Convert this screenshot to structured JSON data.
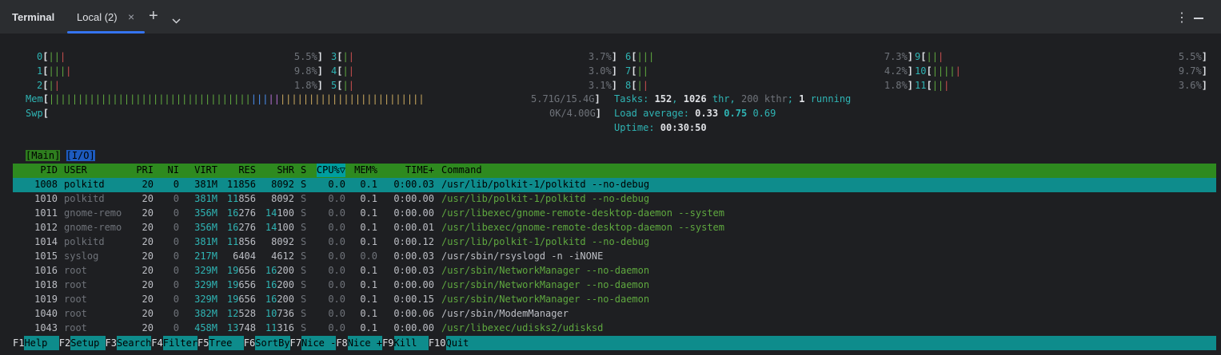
{
  "window": {
    "title": "Terminal",
    "tab_label": "Local (2)",
    "close_glyph": "×",
    "add_glyph": "+",
    "more_glyph": "⋮"
  },
  "cpus": [
    {
      "id": "0",
      "pct": "5.5%"
    },
    {
      "id": "1",
      "pct": "9.8%"
    },
    {
      "id": "2",
      "pct": "1.8%"
    },
    {
      "id": "3",
      "pct": "3.7%"
    },
    {
      "id": "4",
      "pct": "3.0%"
    },
    {
      "id": "5",
      "pct": "3.1%"
    },
    {
      "id": "6",
      "pct": "7.3%"
    },
    {
      "id": "7",
      "pct": "4.2%"
    },
    {
      "id": "8",
      "pct": "1.8%"
    },
    {
      "id": "9",
      "pct": "5.5%"
    },
    {
      "id": "10",
      "pct": "9.7%"
    },
    {
      "id": "11",
      "pct": "3.6%"
    }
  ],
  "mem": {
    "label": "Mem",
    "value": "5.71G/15.4G"
  },
  "swp": {
    "label": "Swp",
    "value": "0K/4.00G"
  },
  "tasks": {
    "prefix": "Tasks: ",
    "count": "152",
    "sep1": ", ",
    "threads": "1026",
    "thr_label": " thr",
    "sep2": ", ",
    "kthr": "200 kthr",
    "sep3": "; ",
    "running": "1",
    "running_label": " running"
  },
  "load": {
    "prefix": "Load average: ",
    "l1": "0.33",
    "l5": "0.75",
    "l15": "0.69"
  },
  "uptime": {
    "prefix": "Uptime: ",
    "value": "00:30:50"
  },
  "view_tabs": {
    "main": "[Main]",
    "io": "[I/O]"
  },
  "columns": {
    "pid": "PID",
    "user": "USER",
    "pri": "PRI",
    "ni": "NI",
    "virt": "VIRT",
    "res": "RES",
    "shr": "SHR",
    "s": "S",
    "cpu": "CPU%▽",
    "mem": "MEM%",
    "time": "TIME+",
    "command": "Command"
  },
  "processes": [
    {
      "pid": "1008",
      "user": "polkitd",
      "pri": "20",
      "ni": "0",
      "virt": "381M",
      "res": "11856",
      "shr": "8092",
      "s": "S",
      "cpu": "0.0",
      "mem": "0.1",
      "time": "0:00.03",
      "cmd": "/usr/lib/polkit-1/polkitd --no-debug"
    },
    {
      "pid": "1010",
      "user": "polkitd",
      "pri": "20",
      "ni": "0",
      "virt": "381M",
      "res": "11856",
      "shr": "8092",
      "s": "S",
      "cpu": "0.0",
      "mem": "0.1",
      "time": "0:00.00",
      "cmd": "/usr/lib/polkit-1/polkitd --no-debug"
    },
    {
      "pid": "1011",
      "user": "gnome-remo",
      "pri": "20",
      "ni": "0",
      "virt": "356M",
      "res": "16276",
      "shr": "14100",
      "s": "S",
      "cpu": "0.0",
      "mem": "0.1",
      "time": "0:00.00",
      "cmd": "/usr/libexec/gnome-remote-desktop-daemon --system"
    },
    {
      "pid": "1012",
      "user": "gnome-remo",
      "pri": "20",
      "ni": "0",
      "virt": "356M",
      "res": "16276",
      "shr": "14100",
      "s": "S",
      "cpu": "0.0",
      "mem": "0.1",
      "time": "0:00.01",
      "cmd": "/usr/libexec/gnome-remote-desktop-daemon --system"
    },
    {
      "pid": "1014",
      "user": "polkitd",
      "pri": "20",
      "ni": "0",
      "virt": "381M",
      "res": "11856",
      "shr": "8092",
      "s": "S",
      "cpu": "0.0",
      "mem": "0.1",
      "time": "0:00.12",
      "cmd": "/usr/lib/polkit-1/polkitd --no-debug"
    },
    {
      "pid": "1015",
      "user": "syslog",
      "pri": "20",
      "ni": "0",
      "virt": "217M",
      "res": "6404",
      "shr": "4612",
      "s": "S",
      "cpu": "0.0",
      "mem": "0.0",
      "time": "0:00.03",
      "cmd": "/usr/sbin/rsyslogd -n -iNONE"
    },
    {
      "pid": "1016",
      "user": "root",
      "pri": "20",
      "ni": "0",
      "virt": "329M",
      "res": "19656",
      "shr": "16200",
      "s": "S",
      "cpu": "0.0",
      "mem": "0.1",
      "time": "0:00.03",
      "cmd": "/usr/sbin/NetworkManager --no-daemon"
    },
    {
      "pid": "1018",
      "user": "root",
      "pri": "20",
      "ni": "0",
      "virt": "329M",
      "res": "19656",
      "shr": "16200",
      "s": "S",
      "cpu": "0.0",
      "mem": "0.1",
      "time": "0:00.00",
      "cmd": "/usr/sbin/NetworkManager --no-daemon"
    },
    {
      "pid": "1019",
      "user": "root",
      "pri": "20",
      "ni": "0",
      "virt": "329M",
      "res": "19656",
      "shr": "16200",
      "s": "S",
      "cpu": "0.0",
      "mem": "0.1",
      "time": "0:00.15",
      "cmd": "/usr/sbin/NetworkManager --no-daemon"
    },
    {
      "pid": "1040",
      "user": "root",
      "pri": "20",
      "ni": "0",
      "virt": "382M",
      "res": "12528",
      "shr": "10736",
      "s": "S",
      "cpu": "0.0",
      "mem": "0.1",
      "time": "0:00.06",
      "cmd": "/usr/sbin/ModemManager"
    },
    {
      "pid": "1043",
      "user": "root",
      "pri": "20",
      "ni": "0",
      "virt": "458M",
      "res": "13748",
      "shr": "11316",
      "s": "S",
      "cpu": "0.0",
      "mem": "0.1",
      "time": "0:00.00",
      "cmd": "/usr/libexec/udisks2/udisksd"
    }
  ],
  "footer": [
    {
      "key": "F1",
      "label": "Help  "
    },
    {
      "key": "F2",
      "label": "Setup "
    },
    {
      "key": "F3",
      "label": "Search"
    },
    {
      "key": "F4",
      "label": "Filter"
    },
    {
      "key": "F5",
      "label": "Tree  "
    },
    {
      "key": "F6",
      "label": "SortBy"
    },
    {
      "key": "F7",
      "label": "Nice -"
    },
    {
      "key": "F8",
      "label": "Nice +"
    },
    {
      "key": "F9",
      "label": "Kill  "
    },
    {
      "key": "F10",
      "label": "Quit"
    }
  ],
  "colors": {
    "accent": "#3574f0",
    "header_green": "#2e8a1f",
    "selection_cyan": "#0e8c8c",
    "meter_green": "#5fa83f",
    "meter_red": "#c94f4f"
  }
}
